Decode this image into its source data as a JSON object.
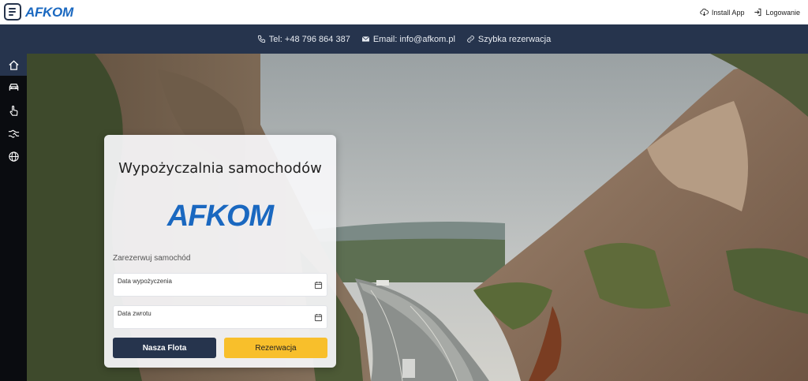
{
  "brand": {
    "name": "AFKOM",
    "color": "#1a68c0"
  },
  "topbar": {
    "install_label": "Install App",
    "login_label": "Logowanie"
  },
  "contact": {
    "phone": "Tel: +48 796 864 387",
    "email": "Email: info@afkom.pl",
    "quick": "Szybka rezerwacja"
  },
  "rail": {
    "items": [
      {
        "icon": "home-icon",
        "active": true
      },
      {
        "icon": "car-icon",
        "active": false
      },
      {
        "icon": "hand-pointer-icon",
        "active": false
      },
      {
        "icon": "handshake-icon",
        "active": false
      },
      {
        "icon": "globe-icon",
        "active": false
      }
    ]
  },
  "card": {
    "title": "Wypożyczalnia samochodów",
    "logo_text": "AFKOM",
    "reserve_label": "Zarezerwuj samochód",
    "pickup_label": "Data wypożyczenia",
    "return_label": "Data zwrotu",
    "fleet_button": "Nasza Flota",
    "reserve_button": "Rezerwacja"
  },
  "colors": {
    "navy": "#26344d",
    "yellow": "#f8bf2b"
  }
}
